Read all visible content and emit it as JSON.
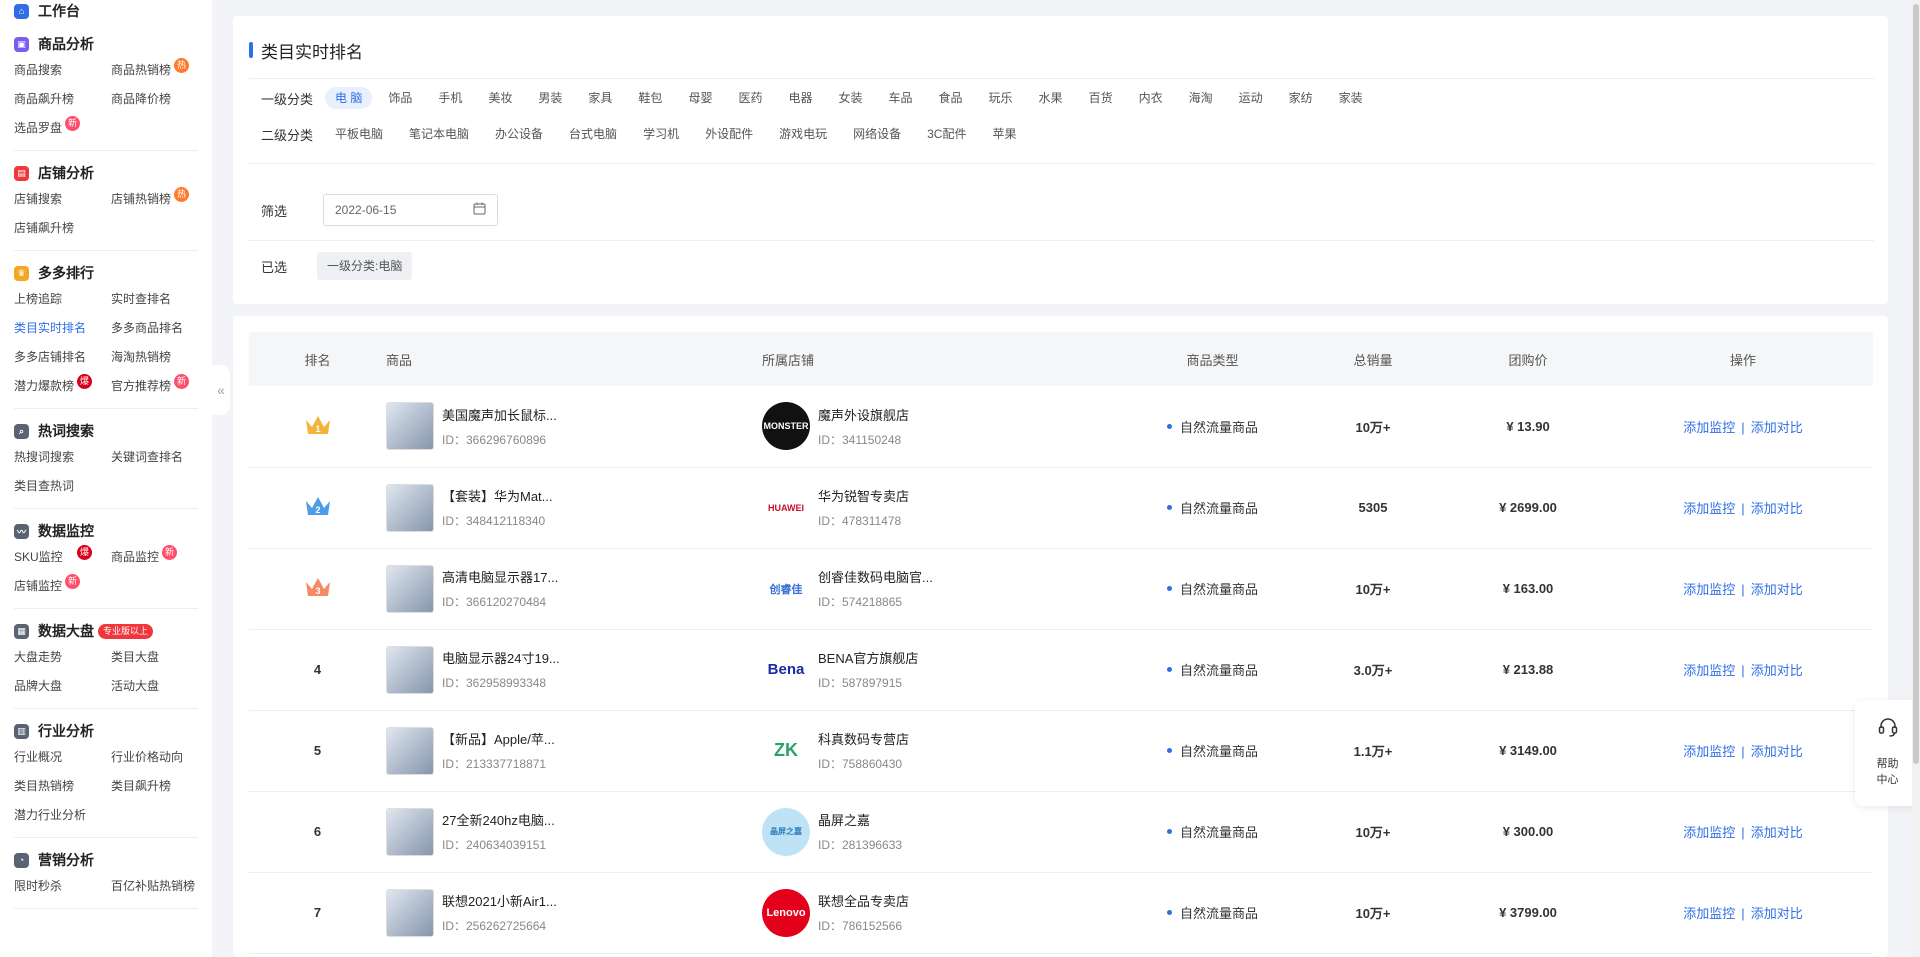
{
  "sidebar": {
    "top": {
      "label": "工作台"
    },
    "sections": [
      {
        "title": "商品分析",
        "items": [
          {
            "label": "商品搜索"
          },
          {
            "label": "商品热销榜",
            "badge": "热"
          },
          {
            "label": "商品飙升榜"
          },
          {
            "label": "商品降价榜"
          },
          {
            "label": "选品罗盘",
            "badge": "新"
          }
        ]
      },
      {
        "title": "店铺分析",
        "items": [
          {
            "label": "店铺搜索"
          },
          {
            "label": "店铺热销榜",
            "badge": "热"
          },
          {
            "label": "店铺飙升榜"
          }
        ]
      },
      {
        "title": "多多排行",
        "items": [
          {
            "label": "上榜追踪"
          },
          {
            "label": "实时查排名"
          },
          {
            "label": "类目实时排名",
            "active": true
          },
          {
            "label": "多多商品排名"
          },
          {
            "label": "多多店铺排名"
          },
          {
            "label": "海淘热销榜"
          },
          {
            "label": "潜力爆款榜",
            "badge": "爆"
          },
          {
            "label": "官方推荐榜",
            "badge": "新"
          }
        ]
      },
      {
        "title": "热词搜索",
        "items": [
          {
            "label": "热搜词搜索"
          },
          {
            "label": "关键词查排名"
          },
          {
            "label": "类目查热词"
          }
        ]
      },
      {
        "title": "数据监控",
        "items": [
          {
            "label": "SKU监控",
            "badge": "爆"
          },
          {
            "label": "商品监控",
            "badge": "新"
          },
          {
            "label": "店铺监控",
            "badge": "新"
          }
        ]
      },
      {
        "title": "数据大盘",
        "tag": "专业版以上",
        "items": [
          {
            "label": "大盘走势"
          },
          {
            "label": "类目大盘"
          },
          {
            "label": "品牌大盘"
          },
          {
            "label": "活动大盘"
          }
        ]
      },
      {
        "title": "行业分析",
        "items": [
          {
            "label": "行业概况"
          },
          {
            "label": "行业价格动向"
          },
          {
            "label": "类目热销榜"
          },
          {
            "label": "类目飙升榜"
          },
          {
            "label": "潜力行业分析"
          }
        ]
      },
      {
        "title": "营销分析",
        "items": [
          {
            "label": "限时秒杀"
          },
          {
            "label": "百亿补贴热销榜"
          }
        ]
      }
    ]
  },
  "filter": {
    "title": "类目实时排名",
    "level1_label": "一级分类",
    "level1_options": [
      "电 脑",
      "饰品",
      "手机",
      "美妆",
      "男装",
      "家具",
      "鞋包",
      "母婴",
      "医药",
      "电器",
      "女装",
      "车品",
      "食品",
      "玩乐",
      "水果",
      "百货",
      "内衣",
      "海淘",
      "运动",
      "家纺",
      "家装"
    ],
    "level2_label": "二级分类",
    "level2_options": [
      "平板电脑",
      "笔记本电脑",
      "办公设备",
      "台式电脑",
      "学习机",
      "外设配件",
      "游戏电玩",
      "网络设备",
      "3C配件",
      "苹果"
    ],
    "screen_label": "筛选",
    "date_value": "2022-06-15",
    "selected_label": "已选",
    "selected_chip": "一级分类:电脑"
  },
  "table": {
    "headers": {
      "rank": "排名",
      "product": "商品",
      "shop": "所属店铺",
      "type": "商品类型",
      "sales": "总销量",
      "price": "团购价",
      "ops": "操作"
    },
    "op_add_monitor": "添加监控",
    "op_sep": "|",
    "op_add_compare": "添加对比",
    "rows": [
      {
        "rank": "1",
        "crown": "gold",
        "name": "美国魔声加长鼠标...",
        "pid": "ID：366296760896",
        "shop": "魔声外设旗舰店",
        "sid": "ID：341150248",
        "logo": "MONSTER",
        "type": "自然流量商品",
        "sales": "10万+",
        "price": "¥ 13.90"
      },
      {
        "rank": "2",
        "crown": "blue",
        "name": "【套装】华为Mat...",
        "pid": "ID：348412118340",
        "shop": "华为锐智专卖店",
        "sid": "ID：478311478",
        "logo": "HUAWEI",
        "type": "自然流量商品",
        "sales": "5305",
        "price": "¥ 2699.00"
      },
      {
        "rank": "3",
        "crown": "orange",
        "name": "高清电脑显示器17...",
        "pid": "ID：366120270484",
        "shop": "创睿佳数码电脑官...",
        "sid": "ID：574218865",
        "logo": "创睿佳",
        "type": "自然流量商品",
        "sales": "10万+",
        "price": "¥ 163.00"
      },
      {
        "rank": "4",
        "name": "电脑显示器24寸19...",
        "pid": "ID：362958993348",
        "shop": "BENA官方旗舰店",
        "sid": "ID：587897915",
        "logo": "Bena",
        "type": "自然流量商品",
        "sales": "3.0万+",
        "price": "¥ 213.88"
      },
      {
        "rank": "5",
        "name": "【新品】Apple/苹...",
        "pid": "ID：213337718871",
        "shop": "科真数码专营店",
        "sid": "ID：758860430",
        "logo": "ZK",
        "type": "自然流量商品",
        "sales": "1.1万+",
        "price": "¥ 3149.00"
      },
      {
        "rank": "6",
        "name": "27全新240hz电脑...",
        "pid": "ID：240634039151",
        "shop": "晶屏之嘉",
        "sid": "ID：281396633",
        "logo": "晶屏之嘉",
        "type": "自然流量商品",
        "sales": "10万+",
        "price": "¥ 300.00"
      },
      {
        "rank": "7",
        "name": "联想2021小新Air1...",
        "pid": "ID：256262725664",
        "shop": "联想全品专卖店",
        "sid": "ID：786152566",
        "logo": "Lenovo",
        "type": "自然流量商品",
        "sales": "10万+",
        "price": "¥ 3799.00"
      }
    ]
  },
  "help": {
    "line1": "帮助",
    "line2": "中心"
  },
  "colors": {
    "accent": "#2f6ee5",
    "crown_gold": "#f5b23d",
    "crown_blue": "#4c9de8",
    "crown_orange": "#f58a64"
  }
}
